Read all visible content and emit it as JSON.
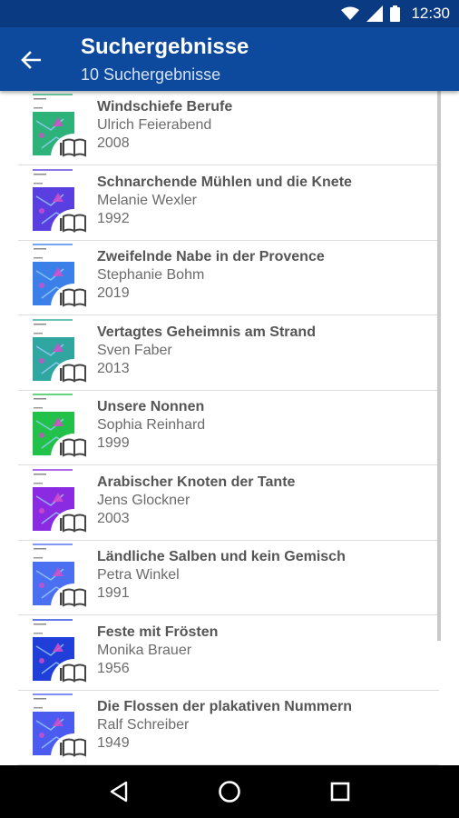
{
  "status_bar": {
    "time": "12:30",
    "icons": [
      "wifi-icon",
      "signal-icon",
      "battery-icon"
    ]
  },
  "app_bar": {
    "back_icon": "arrow-left-icon",
    "title": "Suchergebnisse",
    "subtitle": "10 Suchergebnisse",
    "color": "#0d4a9e"
  },
  "results": [
    {
      "title": "Windschiefe Berufe",
      "author": "Ulrich Feierabend",
      "year": "2008",
      "cover_color": "#2db37a"
    },
    {
      "title": "Schnarchende Mühlen und die Knete",
      "author": "Melanie Wexler",
      "year": "1992",
      "cover_color": "#5a3fe0"
    },
    {
      "title": "Zweifelnde Nabe in der Provence",
      "author": "Stephanie Bohm",
      "year": "2019",
      "cover_color": "#3b7fe8"
    },
    {
      "title": "Vertagtes Geheimnis am Strand",
      "author": "Sven Faber",
      "year": "2013",
      "cover_color": "#2fa7a0"
    },
    {
      "title": "Unsere Nonnen",
      "author": "Sophia Reinhard",
      "year": "1999",
      "cover_color": "#22c24a"
    },
    {
      "title": "Arabischer Knoten der Tante",
      "author": "Jens Glockner",
      "year": "2003",
      "cover_color": "#8a2be2"
    },
    {
      "title": "Ländliche Salben und kein Gemisch",
      "author": "Petra Winkel",
      "year": "1991",
      "cover_color": "#4a6ff0"
    },
    {
      "title": "Feste mit Frösten",
      "author": "Monika Brauer",
      "year": "1956",
      "cover_color": "#1f3fd8"
    },
    {
      "title": "Die Flossen der plakativen Nummern",
      "author": "Ralf Schreiber",
      "year": "1949",
      "cover_color": "#4b5bf0"
    }
  ],
  "nav_bar": {
    "icons": [
      "back-triangle-icon",
      "home-circle-icon",
      "recents-square-icon"
    ]
  }
}
